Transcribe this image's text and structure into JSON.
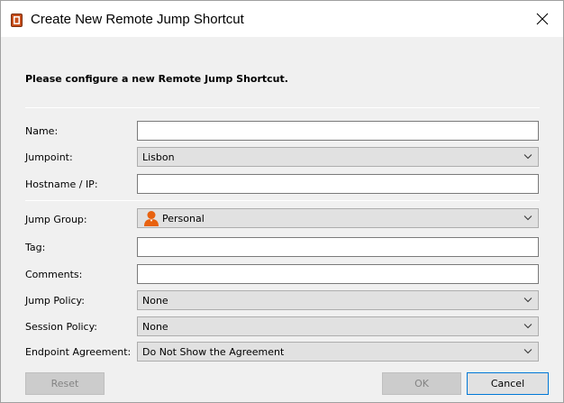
{
  "window": {
    "title": "Create New Remote Jump Shortcut",
    "app_icon": "remote-jump-app-icon",
    "close_icon": "close-icon"
  },
  "heading": "Please configure a new Remote Jump Shortcut.",
  "fields": {
    "name": {
      "label": "Name:",
      "value": ""
    },
    "jumpoint": {
      "label": "Jumpoint:",
      "value": "Lisbon"
    },
    "hostname": {
      "label": "Hostname / IP:",
      "value": ""
    },
    "jump_group": {
      "label": "Jump Group:",
      "value": "Personal",
      "icon": "person-icon"
    },
    "tag": {
      "label": "Tag:",
      "value": ""
    },
    "comments": {
      "label": "Comments:",
      "value": ""
    },
    "jump_policy": {
      "label": "Jump Policy:",
      "value": "None"
    },
    "session_policy": {
      "label": "Session Policy:",
      "value": "None"
    },
    "endpoint_agreement": {
      "label": "Endpoint Agreement:",
      "value": "Do Not Show the Agreement"
    }
  },
  "buttons": {
    "reset": "Reset",
    "ok": "OK",
    "cancel": "Cancel"
  },
  "colors": {
    "person_icon": "#e8620f",
    "primary_border": "#0078d7"
  }
}
